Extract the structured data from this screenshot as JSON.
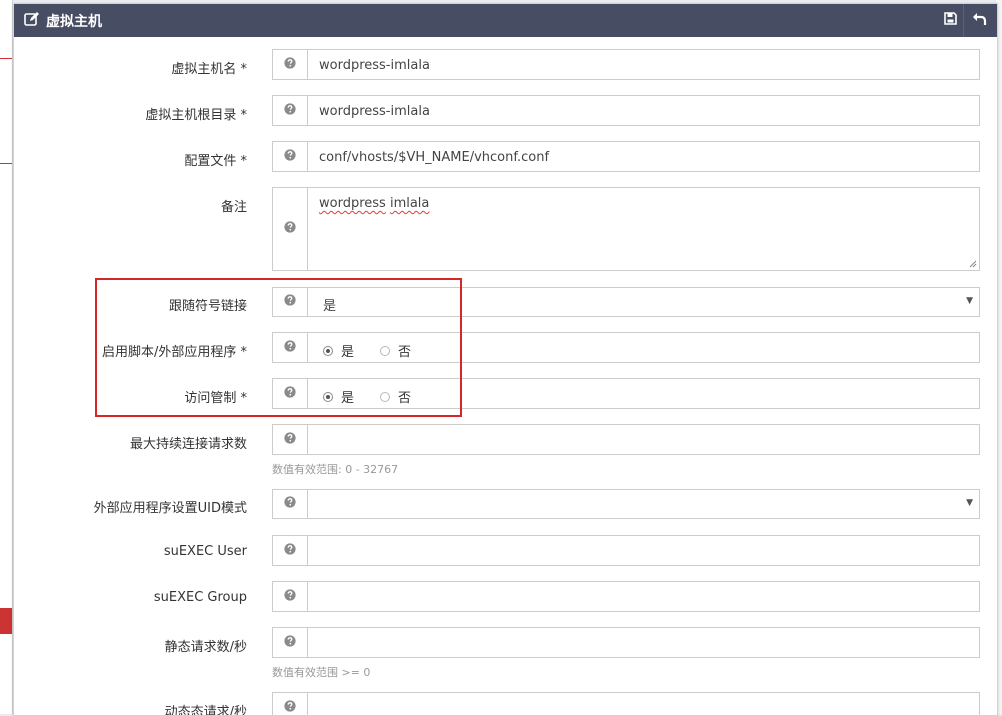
{
  "window": {
    "title": "虚拟主机",
    "edit_icon": "edit-icon",
    "save_icon": "save-icon",
    "back_icon": "back-icon",
    "header_bg": "#474e63",
    "highlight_color": "#d62728"
  },
  "form": {
    "vh_name": {
      "label": "虚拟主机名 *",
      "value": "wordpress-imlala"
    },
    "vh_root": {
      "label": "虚拟主机根目录 *",
      "value": "wordpress-imlala"
    },
    "config_file": {
      "label": "配置文件 *",
      "value": "conf/vhosts/$VH_NAME/vhconf.conf"
    },
    "notes": {
      "label": "备注",
      "value_word1": "wordpress",
      "value_word2": "imlala"
    },
    "follow_symlink": {
      "label": "跟随符号链接",
      "value": "是"
    },
    "enable_script": {
      "label": "启用脚本/外部应用程序 *",
      "options": [
        "是",
        "否"
      ],
      "selected": "是"
    },
    "restrained": {
      "label": "访问管制 *",
      "options": [
        "是",
        "否"
      ],
      "selected": "是"
    },
    "max_keepalive": {
      "label": "最大持续连接请求数",
      "value": "",
      "help": "数值有效范围: 0 - 32767"
    },
    "ext_app_uid_mode": {
      "label": "外部应用程序设置UID模式",
      "value": ""
    },
    "suexec_user": {
      "label": "suEXEC User",
      "value": ""
    },
    "suexec_group": {
      "label": "suEXEC Group",
      "value": ""
    },
    "static_req": {
      "label": "静态请求数/秒",
      "value": "",
      "help": "数值有效范围 >= 0"
    },
    "dynamic_req": {
      "label": "动态态请求/秒",
      "value": ""
    }
  },
  "help_icon": "question-circle-icon"
}
